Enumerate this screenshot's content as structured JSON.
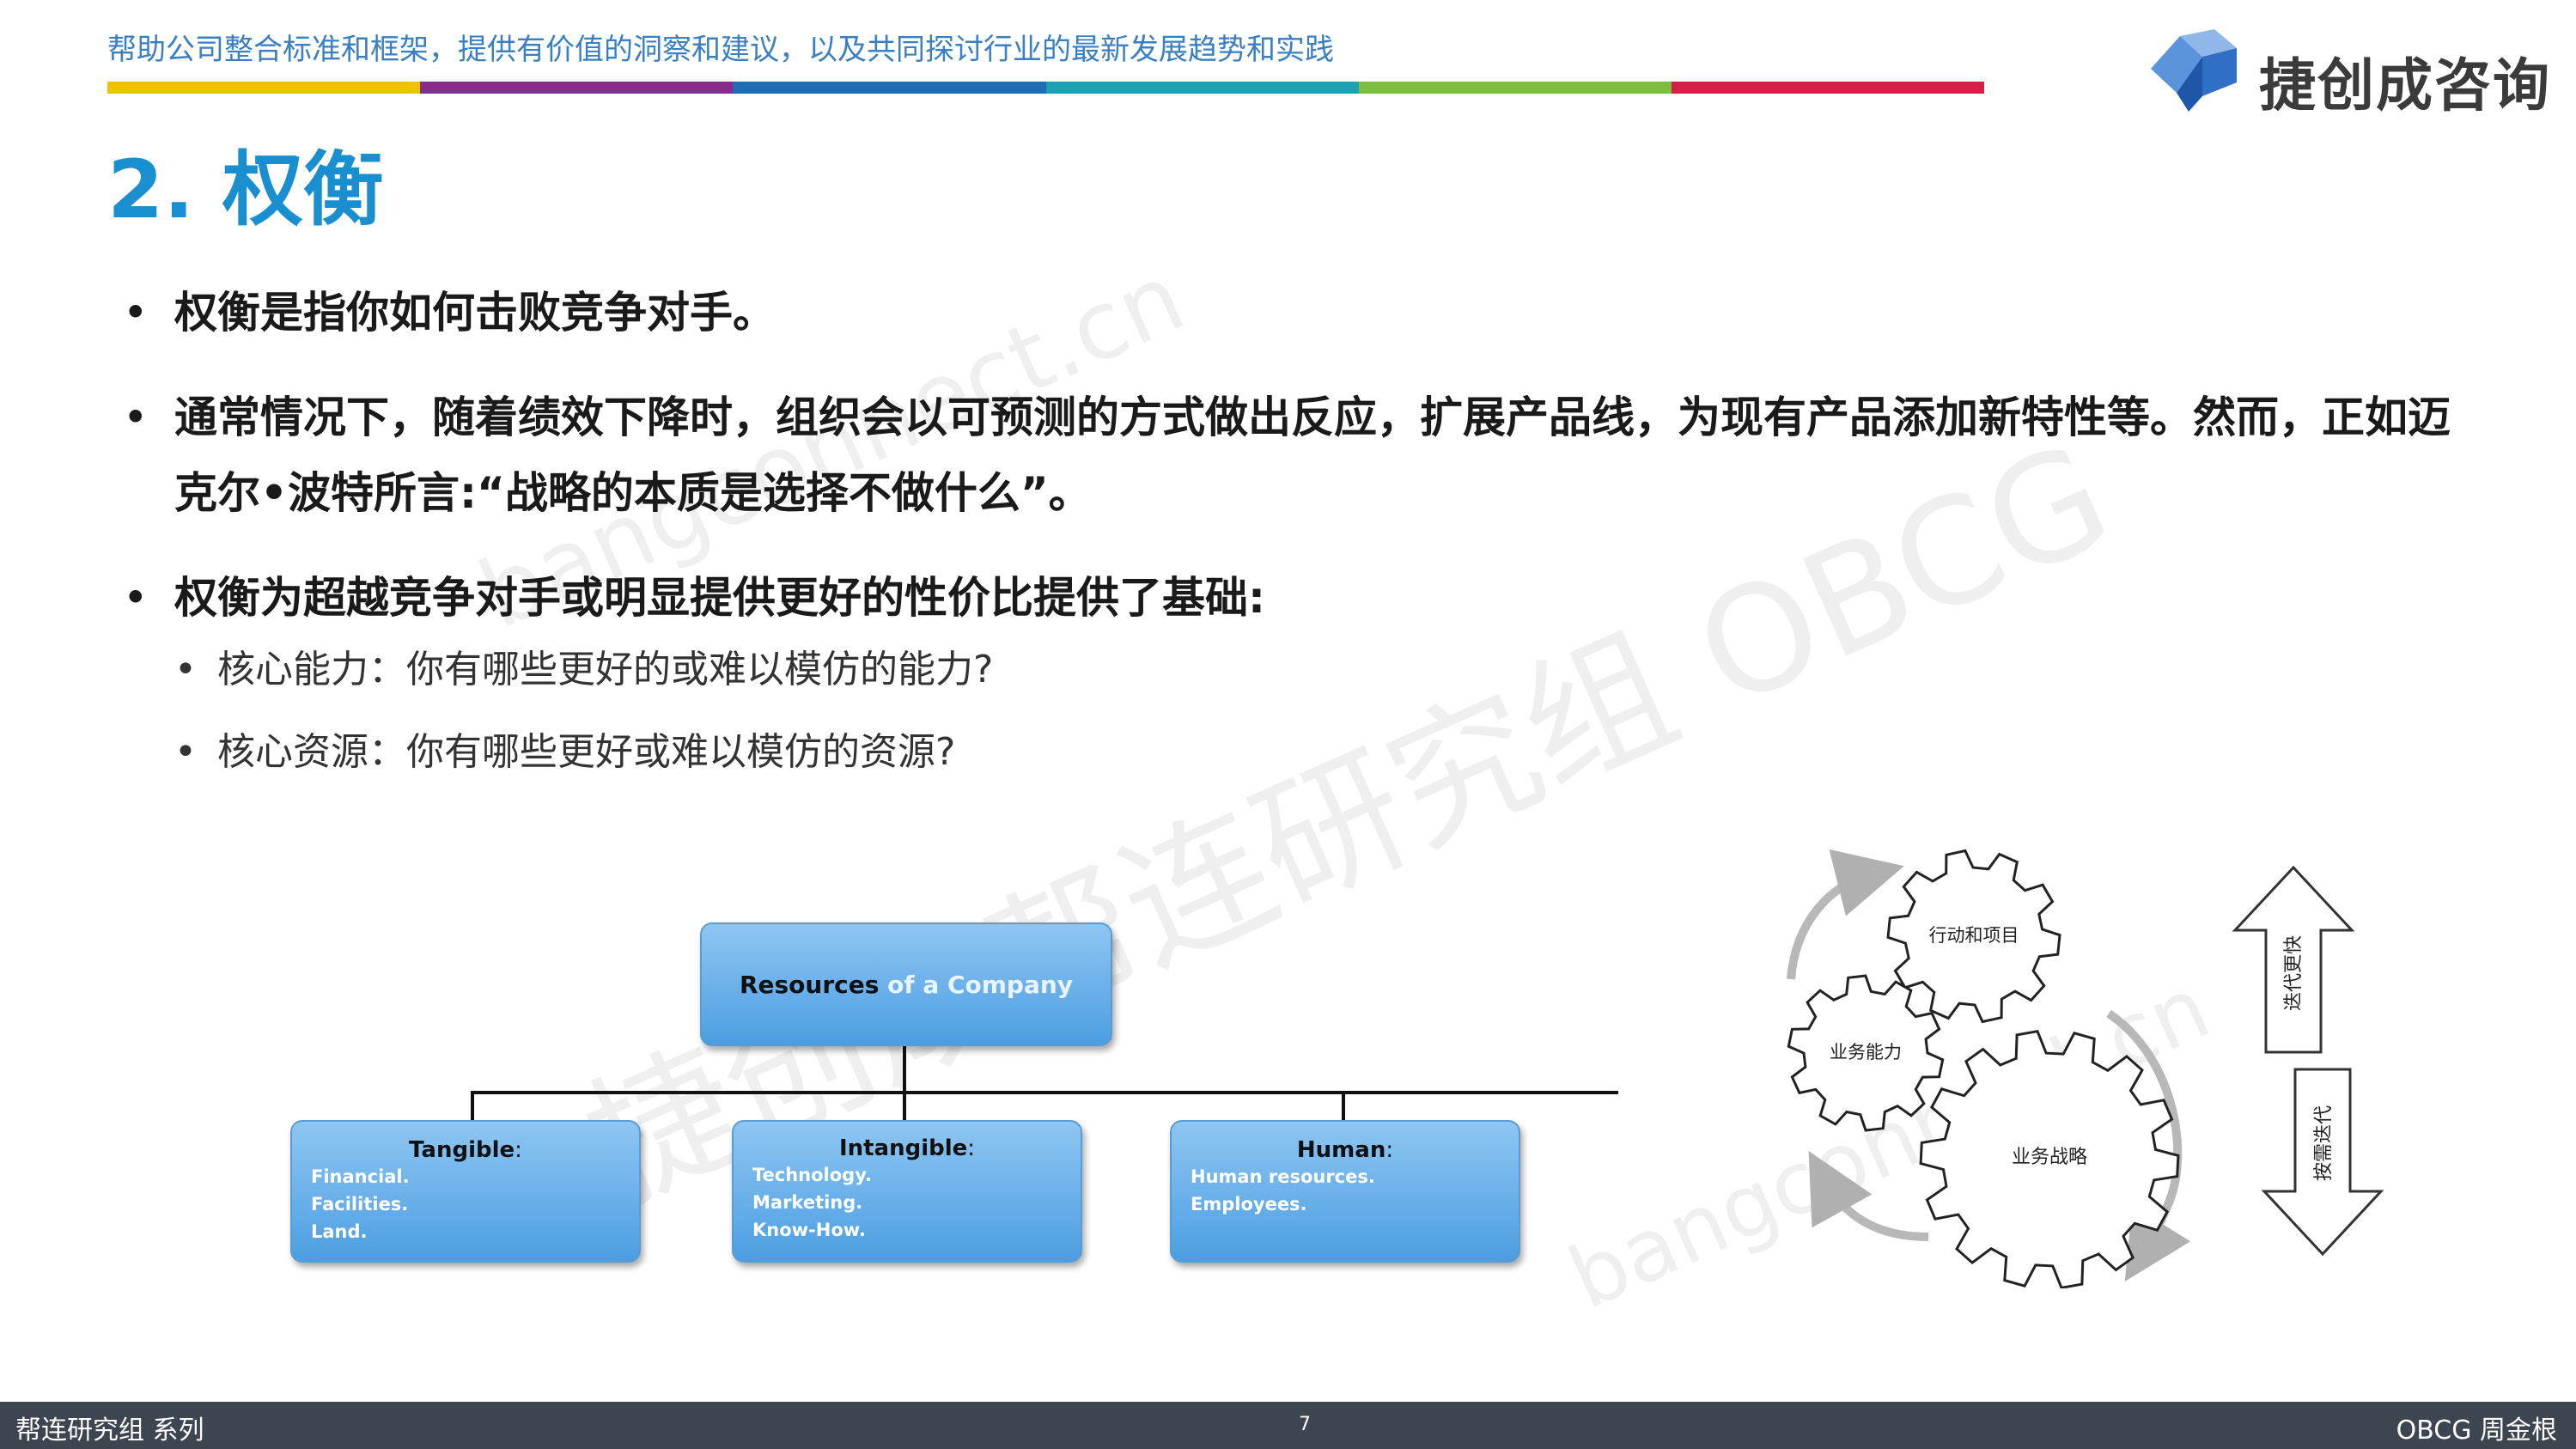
{
  "header": {
    "tagline": "帮助公司整合标准和框架，提供有价值的洞察和建议，以及共同探讨行业的最新发展趋势和实践",
    "logo_text": "捷创成咨询",
    "color_bar": [
      "#f2c200",
      "#8a2a8c",
      "#1e6db7",
      "#1aa3b5",
      "#7cbf3f",
      "#d61f47"
    ]
  },
  "slide": {
    "title": "2. 权衡",
    "bullets": [
      {
        "text": "权衡是指你如何击败竞争对手。"
      },
      {
        "text": "通常情况下，随着绩效下降时，组织会以可预测的方式做出反应，扩展产品线，为现有产品添加新特性等。然而，正如迈克尔•波特所言:“战略的本质是选择不做什么”。"
      },
      {
        "text": "权衡为超越竞争对手或明显提供更好的性价比提供了基础:"
      }
    ],
    "sub_bullets": [
      {
        "text": "核心能力：你有哪些更好的或难以模仿的能力?"
      },
      {
        "text": "核心资源：你有哪些更好或难以模仿的资源?"
      }
    ]
  },
  "watermarks": [
    "捷创成帮连研究组 OBCG",
    "bangconnect.cn",
    "bangconnect.cn"
  ],
  "org_chart": {
    "root": {
      "label_dark": "Resources",
      "label_light": " of a Company"
    },
    "children": [
      {
        "title": "Tangible",
        "colon": ":",
        "items": [
          "Financial.",
          "Facilities.",
          "Land."
        ]
      },
      {
        "title": "Intangible",
        "colon": ":",
        "items": [
          "Technology.",
          "Marketing.",
          "Know-How."
        ]
      },
      {
        "title": "Human",
        "colon": ":",
        "items": [
          "Human resources.",
          "Employees."
        ]
      }
    ]
  },
  "gears": {
    "top": "行动和项目",
    "left": "业务能力",
    "big": "业务战略"
  },
  "arrows": {
    "up": "迭代更快",
    "down": "按需迭代"
  },
  "footer": {
    "left": "帮连研究组 系列",
    "page": "7",
    "right": "OBCG 周金根"
  }
}
